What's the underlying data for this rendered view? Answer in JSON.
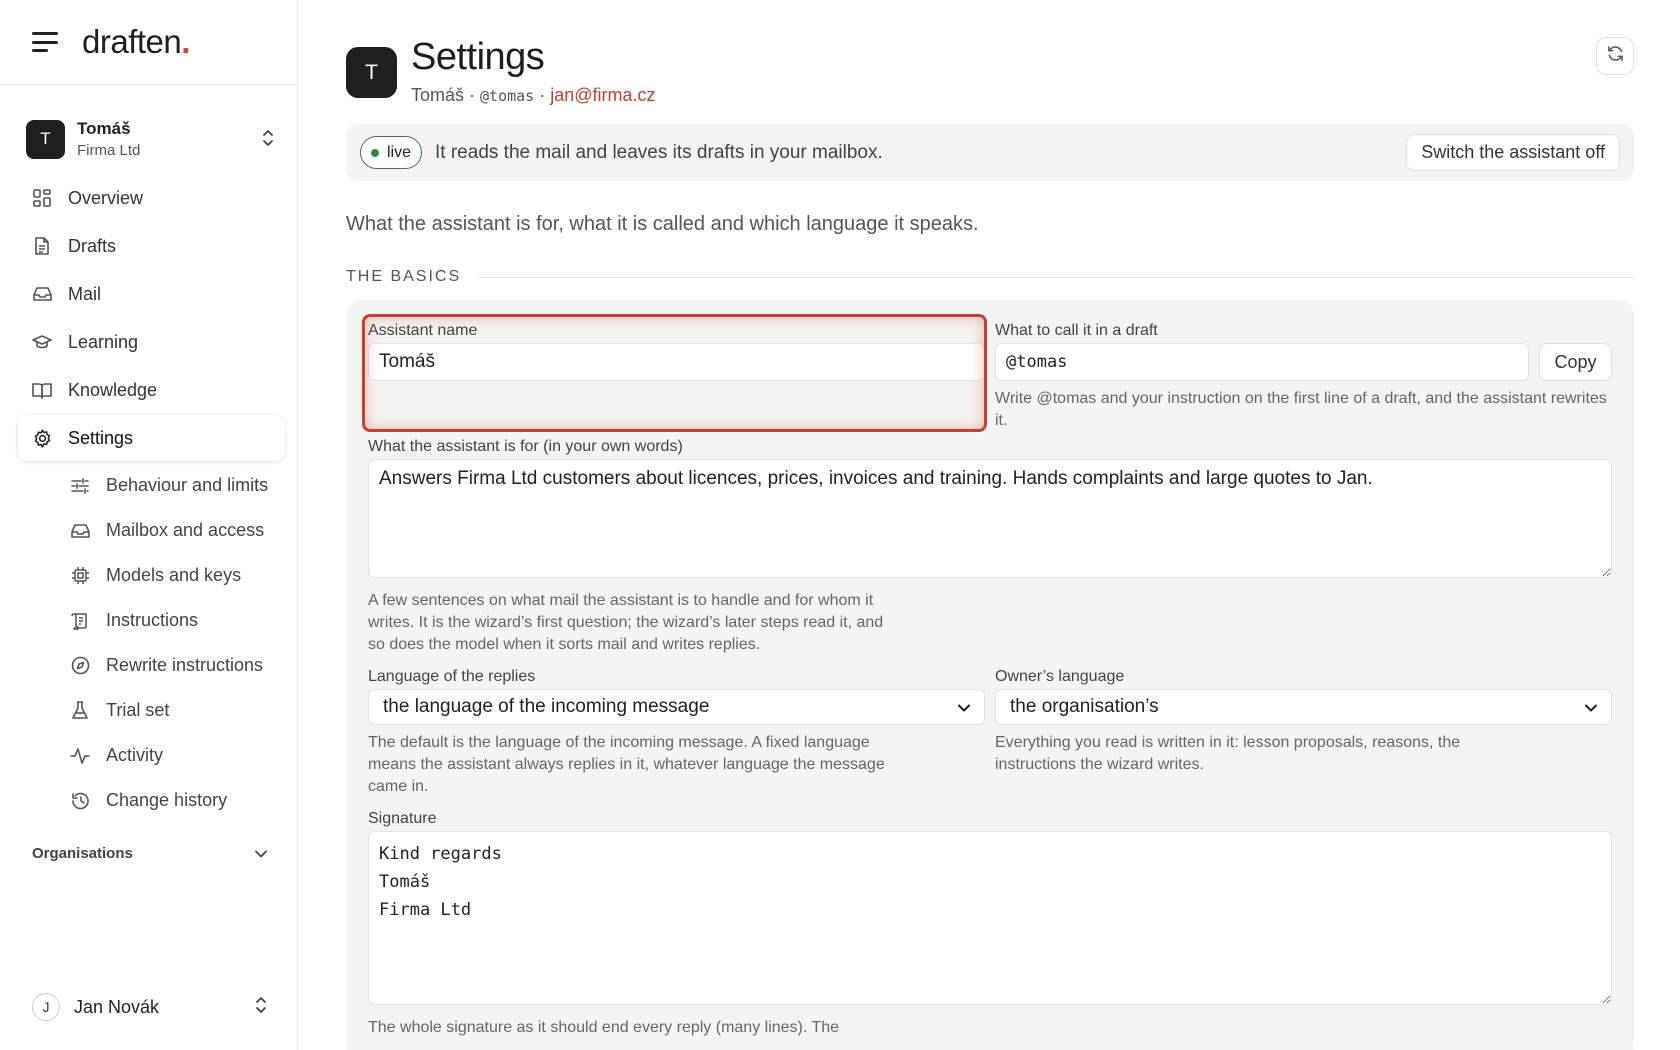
{
  "brand": {
    "name": "draften",
    "dot": "."
  },
  "assistant": {
    "name": "Tomáš",
    "org": "Firma Ltd",
    "avatar_letter": "T"
  },
  "nav": {
    "overview": "Overview",
    "drafts": "Drafts",
    "mail": "Mail",
    "learning": "Learning",
    "knowledge": "Knowledge",
    "settings": "Settings"
  },
  "subnav": {
    "behaviour": "Behaviour and limits",
    "mailbox": "Mailbox and access",
    "models": "Models and keys",
    "instructions": "Instructions",
    "rewrite": "Rewrite instructions",
    "trial": "Trial set",
    "activity": "Activity",
    "history": "Change history"
  },
  "organisations_label": "Organisations",
  "user": {
    "name": "Jan Novák",
    "initial": "J"
  },
  "header": {
    "avatar_letter": "T",
    "title": "Settings",
    "sub_name": "Tomáš",
    "sep": " · ",
    "handle": "@tomas",
    "email": "jan@firma.cz"
  },
  "banner": {
    "status": "live",
    "text": "It reads the mail and leaves its drafts in your mailbox.",
    "switch_off": "Switch the assistant off"
  },
  "intro": "What the assistant is for, what it is called and which language it speaks.",
  "section_label": "THE BASICS",
  "fields": {
    "name_label": "Assistant name",
    "name_value": "Tomáš",
    "call_label": "What to call it in a draft",
    "call_value": "@tomas",
    "copy": "Copy",
    "call_hint": "Write @tomas and your instruction on the first line of a draft, and the assistant rewrites it.",
    "purpose_label": "What the assistant is for (in your own words)",
    "purpose_value": "Answers Firma Ltd customers about licences, prices, invoices and training. Hands complaints and large quotes to Jan.",
    "purpose_hint": "A few sentences on what mail the assistant is to handle and for whom it writes. It is the wizard’s first question; the wizard’s later steps read it, and so does the model when it sorts mail and writes replies.",
    "reply_lang_label": "Language of the replies",
    "reply_lang_value": "the language of the incoming message",
    "reply_lang_hint": "The default is the language of the incoming message. A fixed language means the assistant always replies in it, whatever language the message came in.",
    "owner_lang_label": "Owner’s language",
    "owner_lang_value": "the organisation’s",
    "owner_lang_hint": "Everything you read is written in it: lesson proposals, reasons, the instructions the wizard writes.",
    "signature_label": "Signature",
    "signature_value": "Kind regards\nTomáš\nFirma Ltd",
    "signature_hint": "The whole signature as it should end every reply (many lines). The"
  }
}
